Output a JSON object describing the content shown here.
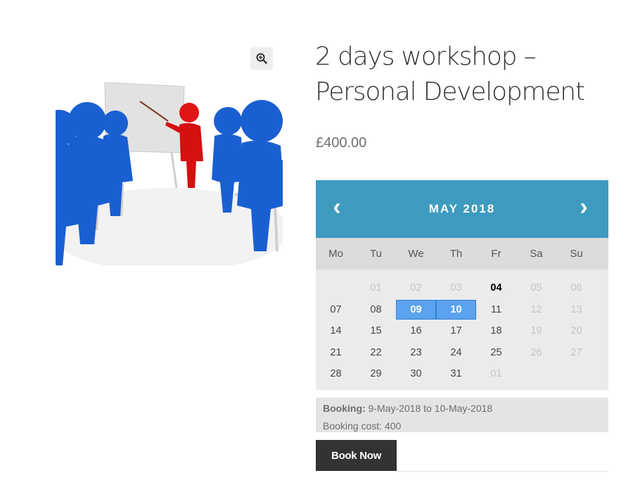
{
  "product": {
    "title": "2 days workshop – Personal Development",
    "price": "£400.00",
    "image_alt": "Presentation illustration with blue figures watching a red presenter at a flipchart"
  },
  "icons": {
    "zoom": "zoom-in-icon",
    "prev": "chevron-left-icon",
    "next": "chevron-right-icon"
  },
  "calendar": {
    "month_label": "MAY 2018",
    "prev_glyph": "‹",
    "next_glyph": "›",
    "weekdays": [
      "Mo",
      "Tu",
      "We",
      "Th",
      "Fr",
      "Sa",
      "Su"
    ],
    "days": [
      {
        "label": "",
        "state": "empty"
      },
      {
        "label": "01",
        "state": "muted"
      },
      {
        "label": "02",
        "state": "muted"
      },
      {
        "label": "03",
        "state": "muted"
      },
      {
        "label": "04",
        "state": "today"
      },
      {
        "label": "05",
        "state": "muted"
      },
      {
        "label": "06",
        "state": "muted"
      },
      {
        "label": "07",
        "state": "available"
      },
      {
        "label": "08",
        "state": "available"
      },
      {
        "label": "09",
        "state": "selected"
      },
      {
        "label": "10",
        "state": "selected"
      },
      {
        "label": "11",
        "state": "available"
      },
      {
        "label": "12",
        "state": "muted"
      },
      {
        "label": "13",
        "state": "muted"
      },
      {
        "label": "14",
        "state": "available"
      },
      {
        "label": "15",
        "state": "available"
      },
      {
        "label": "16",
        "state": "available"
      },
      {
        "label": "17",
        "state": "available"
      },
      {
        "label": "18",
        "state": "available"
      },
      {
        "label": "19",
        "state": "muted"
      },
      {
        "label": "20",
        "state": "muted"
      },
      {
        "label": "21",
        "state": "available"
      },
      {
        "label": "22",
        "state": "available"
      },
      {
        "label": "23",
        "state": "available"
      },
      {
        "label": "24",
        "state": "available"
      },
      {
        "label": "25",
        "state": "available"
      },
      {
        "label": "26",
        "state": "muted"
      },
      {
        "label": "27",
        "state": "muted"
      },
      {
        "label": "28",
        "state": "available"
      },
      {
        "label": "29",
        "state": "available"
      },
      {
        "label": "30",
        "state": "available"
      },
      {
        "label": "31",
        "state": "available"
      },
      {
        "label": "01",
        "state": "muted"
      }
    ],
    "colors": {
      "header": "#3e9bbf",
      "selected": "#5ba3ee"
    }
  },
  "booking": {
    "label": "Booking:",
    "dates": "9-May-2018 to 10-May-2018",
    "cost": "Booking cost: 400"
  },
  "actions": {
    "book_now": "Book Now"
  }
}
